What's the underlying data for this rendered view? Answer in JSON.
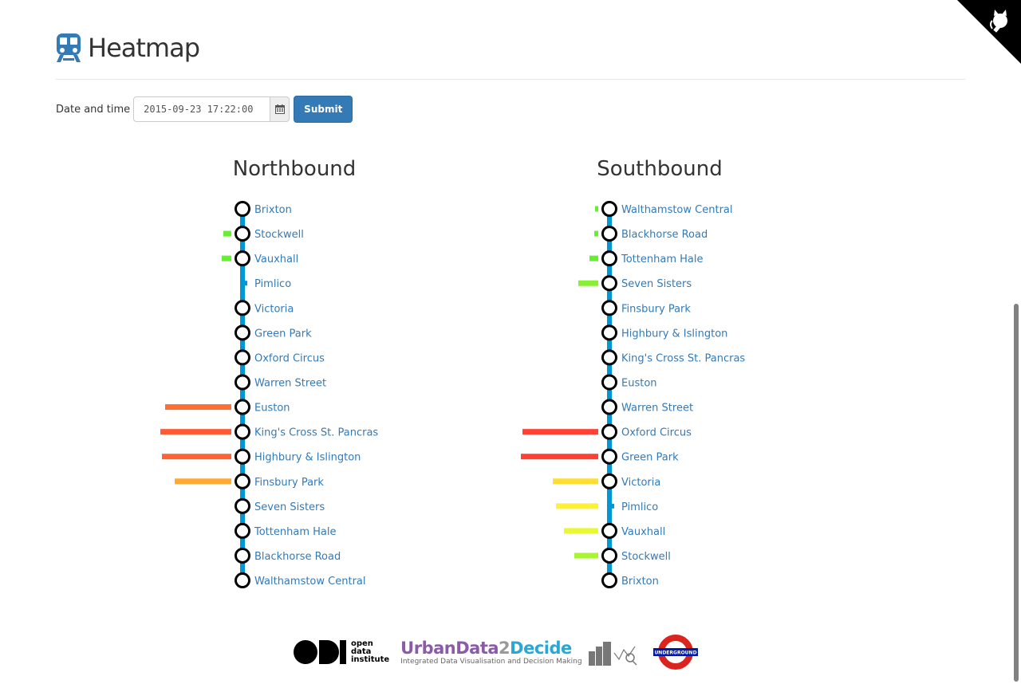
{
  "header": {
    "title": "Heatmap",
    "icon": "train-icon"
  },
  "form": {
    "label": "Date and time",
    "datetime_value": "2015-09-23 17:22:00",
    "calendar_icon": "calendar-icon",
    "submit_label": "Submit"
  },
  "corner": {
    "icon": "github-octocat-icon"
  },
  "footer": {
    "odi_text": [
      "open",
      "data",
      "institute"
    ],
    "ud_part1": "UrbanData",
    "ud_part2": "2",
    "ud_part3": "Decide",
    "ud_subtitle": "Integrated Data Visualisation and Decision Making",
    "underground_text": "UNDERGROUND"
  },
  "chart_data": [
    {
      "type": "bar",
      "title": "Northbound",
      "orientation": "horizontal",
      "line_color": "#0098d4",
      "stations": [
        {
          "name": "Brixton",
          "value": 0,
          "color": null,
          "interchange": true
        },
        {
          "name": "Stockwell",
          "value": 10,
          "color": "#66ee33",
          "interchange": true
        },
        {
          "name": "Vauxhall",
          "value": 12,
          "color": "#66ee33",
          "interchange": true
        },
        {
          "name": "Pimlico",
          "value": 0,
          "color": null,
          "interchange": false
        },
        {
          "name": "Victoria",
          "value": 0,
          "color": null,
          "interchange": true
        },
        {
          "name": "Green Park",
          "value": 0,
          "color": null,
          "interchange": true
        },
        {
          "name": "Oxford Circus",
          "value": 0,
          "color": null,
          "interchange": true
        },
        {
          "name": "Warren Street",
          "value": 0,
          "color": null,
          "interchange": true
        },
        {
          "name": "Euston",
          "value": 83,
          "color": "#ff6f33",
          "interchange": true
        },
        {
          "name": "King's Cross St. Pancras",
          "value": 89,
          "color": "#ff5a33",
          "interchange": true
        },
        {
          "name": "Highbury & Islington",
          "value": 87,
          "color": "#ff6333",
          "interchange": true
        },
        {
          "name": "Finsbury Park",
          "value": 71,
          "color": "#ffa833",
          "interchange": true
        },
        {
          "name": "Seven Sisters",
          "value": 0,
          "color": null,
          "interchange": true
        },
        {
          "name": "Tottenham Hale",
          "value": 0,
          "color": null,
          "interchange": true
        },
        {
          "name": "Blackhorse Road",
          "value": 0,
          "color": null,
          "interchange": true
        },
        {
          "name": "Walthamstow Central",
          "value": 0,
          "color": null,
          "interchange": true
        }
      ]
    },
    {
      "type": "bar",
      "title": "Southbound",
      "orientation": "horizontal",
      "line_color": "#0098d4",
      "stations": [
        {
          "name": "Walthamstow Central",
          "value": 4,
          "color": "#66ee33",
          "interchange": true
        },
        {
          "name": "Blackhorse Road",
          "value": 5,
          "color": "#66ee33",
          "interchange": true
        },
        {
          "name": "Tottenham Hale",
          "value": 11,
          "color": "#66ee33",
          "interchange": true
        },
        {
          "name": "Seven Sisters",
          "value": 25,
          "color": "#88f033",
          "interchange": true
        },
        {
          "name": "Finsbury Park",
          "value": 0,
          "color": null,
          "interchange": true
        },
        {
          "name": "Highbury & Islington",
          "value": 0,
          "color": null,
          "interchange": true
        },
        {
          "name": "King's Cross St. Pancras",
          "value": 0,
          "color": null,
          "interchange": true
        },
        {
          "name": "Euston",
          "value": 0,
          "color": null,
          "interchange": true
        },
        {
          "name": "Warren Street",
          "value": 0,
          "color": null,
          "interchange": true
        },
        {
          "name": "Oxford Circus",
          "value": 95,
          "color": "#ff4233",
          "interchange": true
        },
        {
          "name": "Green Park",
          "value": 97,
          "color": "#ff4033",
          "interchange": true
        },
        {
          "name": "Victoria",
          "value": 57,
          "color": "#ffdd33",
          "interchange": true
        },
        {
          "name": "Pimlico",
          "value": 53,
          "color": "#fff033",
          "interchange": false
        },
        {
          "name": "Vauxhall",
          "value": 43,
          "color": "#e8f833",
          "interchange": true
        },
        {
          "name": "Stockwell",
          "value": 30,
          "color": "#aaf533",
          "interchange": true
        },
        {
          "name": "Brixton",
          "value": 0,
          "color": null,
          "interchange": true
        }
      ]
    }
  ]
}
